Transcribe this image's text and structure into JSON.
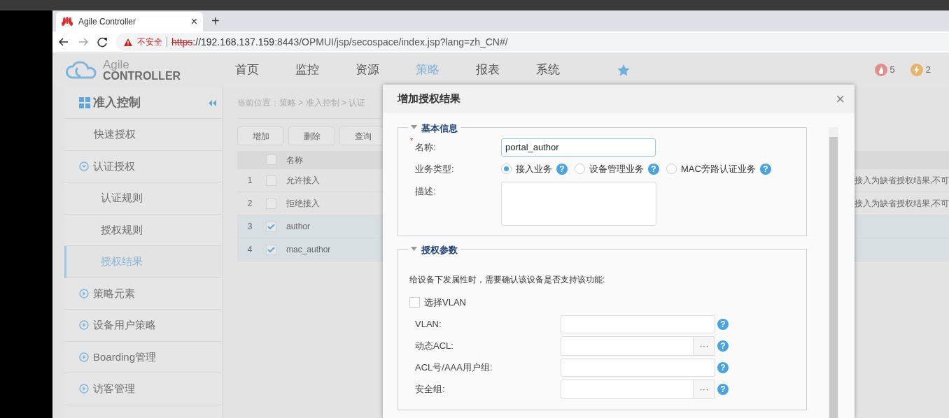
{
  "browser": {
    "tab_title": "Agile Controller",
    "tab_close": "×",
    "new_tab": "+",
    "security_label": "不安全",
    "url_scheme": "https",
    "url_host": "://192.168.137.159",
    "url_path": ":8443/OPMUI/jsp/secospace/index.jsp?lang=zh_CN#/"
  },
  "app": {
    "logo_line1": "Agile",
    "logo_line2": "CONTROLLER",
    "nav": [
      {
        "label": "首页",
        "selected": false
      },
      {
        "label": "监控",
        "selected": false
      },
      {
        "label": "资源",
        "selected": false
      },
      {
        "label": "策略",
        "selected": true
      },
      {
        "label": "报表",
        "selected": false
      },
      {
        "label": "系统",
        "selected": false
      }
    ],
    "alerts": [
      {
        "kind": "fire",
        "count": "5",
        "color": "#e08f8a"
      },
      {
        "kind": "bolt",
        "count": "2",
        "color": "#e6b46e"
      }
    ]
  },
  "sidebar": {
    "title": "准入控制",
    "items": [
      {
        "label": "快速授权",
        "kind": "leaf",
        "selected": false
      },
      {
        "label": "认证授权",
        "kind": "group",
        "expanded": true,
        "children": [
          {
            "label": "认证规则",
            "selected": false
          },
          {
            "label": "授权规则",
            "selected": false
          },
          {
            "label": "授权结果",
            "selected": true
          }
        ]
      },
      {
        "label": "策略元素",
        "kind": "group",
        "expanded": false
      },
      {
        "label": "设备用户策略",
        "kind": "group",
        "expanded": false
      },
      {
        "label": "Boarding管理",
        "kind": "group",
        "expanded": false
      },
      {
        "label": "访客管理",
        "kind": "group",
        "expanded": false
      }
    ]
  },
  "breadcrumb": "当前位置：策略 > 准入控制 > 认证",
  "toolbar": [
    "增加",
    "删除",
    "查询"
  ],
  "table": {
    "columns": [
      "名称"
    ],
    "header_checked": false,
    "rows": [
      {
        "index": "1",
        "name": "允许接入",
        "description": "接入为缺省授权结果,不可",
        "selected": false
      },
      {
        "index": "2",
        "name": "拒绝接入",
        "description": "接入为缺省授权结果,不可",
        "selected": false
      },
      {
        "index": "3",
        "name": "author",
        "selected": true
      },
      {
        "index": "4",
        "name": "mac_author",
        "selected": true
      }
    ]
  },
  "dialog": {
    "title": "增加授权结果",
    "close": "×",
    "basic": {
      "legend": "基本信息",
      "expanded": true,
      "name_label": "名称:",
      "required": true,
      "required_mark": "*",
      "name_value": "portal_author",
      "type_label": "业务类型:",
      "types": [
        {
          "label": "接入业务",
          "selected": true,
          "help": "?"
        },
        {
          "label": "设备管理业务",
          "selected": false,
          "help": "?"
        },
        {
          "label": "MAC旁路认证业务",
          "selected": false,
          "help": "?"
        }
      ],
      "desc_label": "描述:"
    },
    "auth": {
      "legend": "授权参数",
      "expanded": true,
      "note": "给设备下发属性时，需要确认该设备是否支持该功能:",
      "vlan_check": {
        "label": "选择VLAN",
        "checked": false
      },
      "fields": [
        {
          "label": "VLAN:",
          "kind": "text",
          "help": "?"
        },
        {
          "label": "动态ACL:",
          "kind": "picker",
          "button": "···",
          "help": "?"
        },
        {
          "label": "ACL号/AAA用户组:",
          "kind": "text",
          "help": "?"
        },
        {
          "label": "安全组:",
          "kind": "picker",
          "button": "···",
          "help": "?"
        }
      ]
    }
  }
}
